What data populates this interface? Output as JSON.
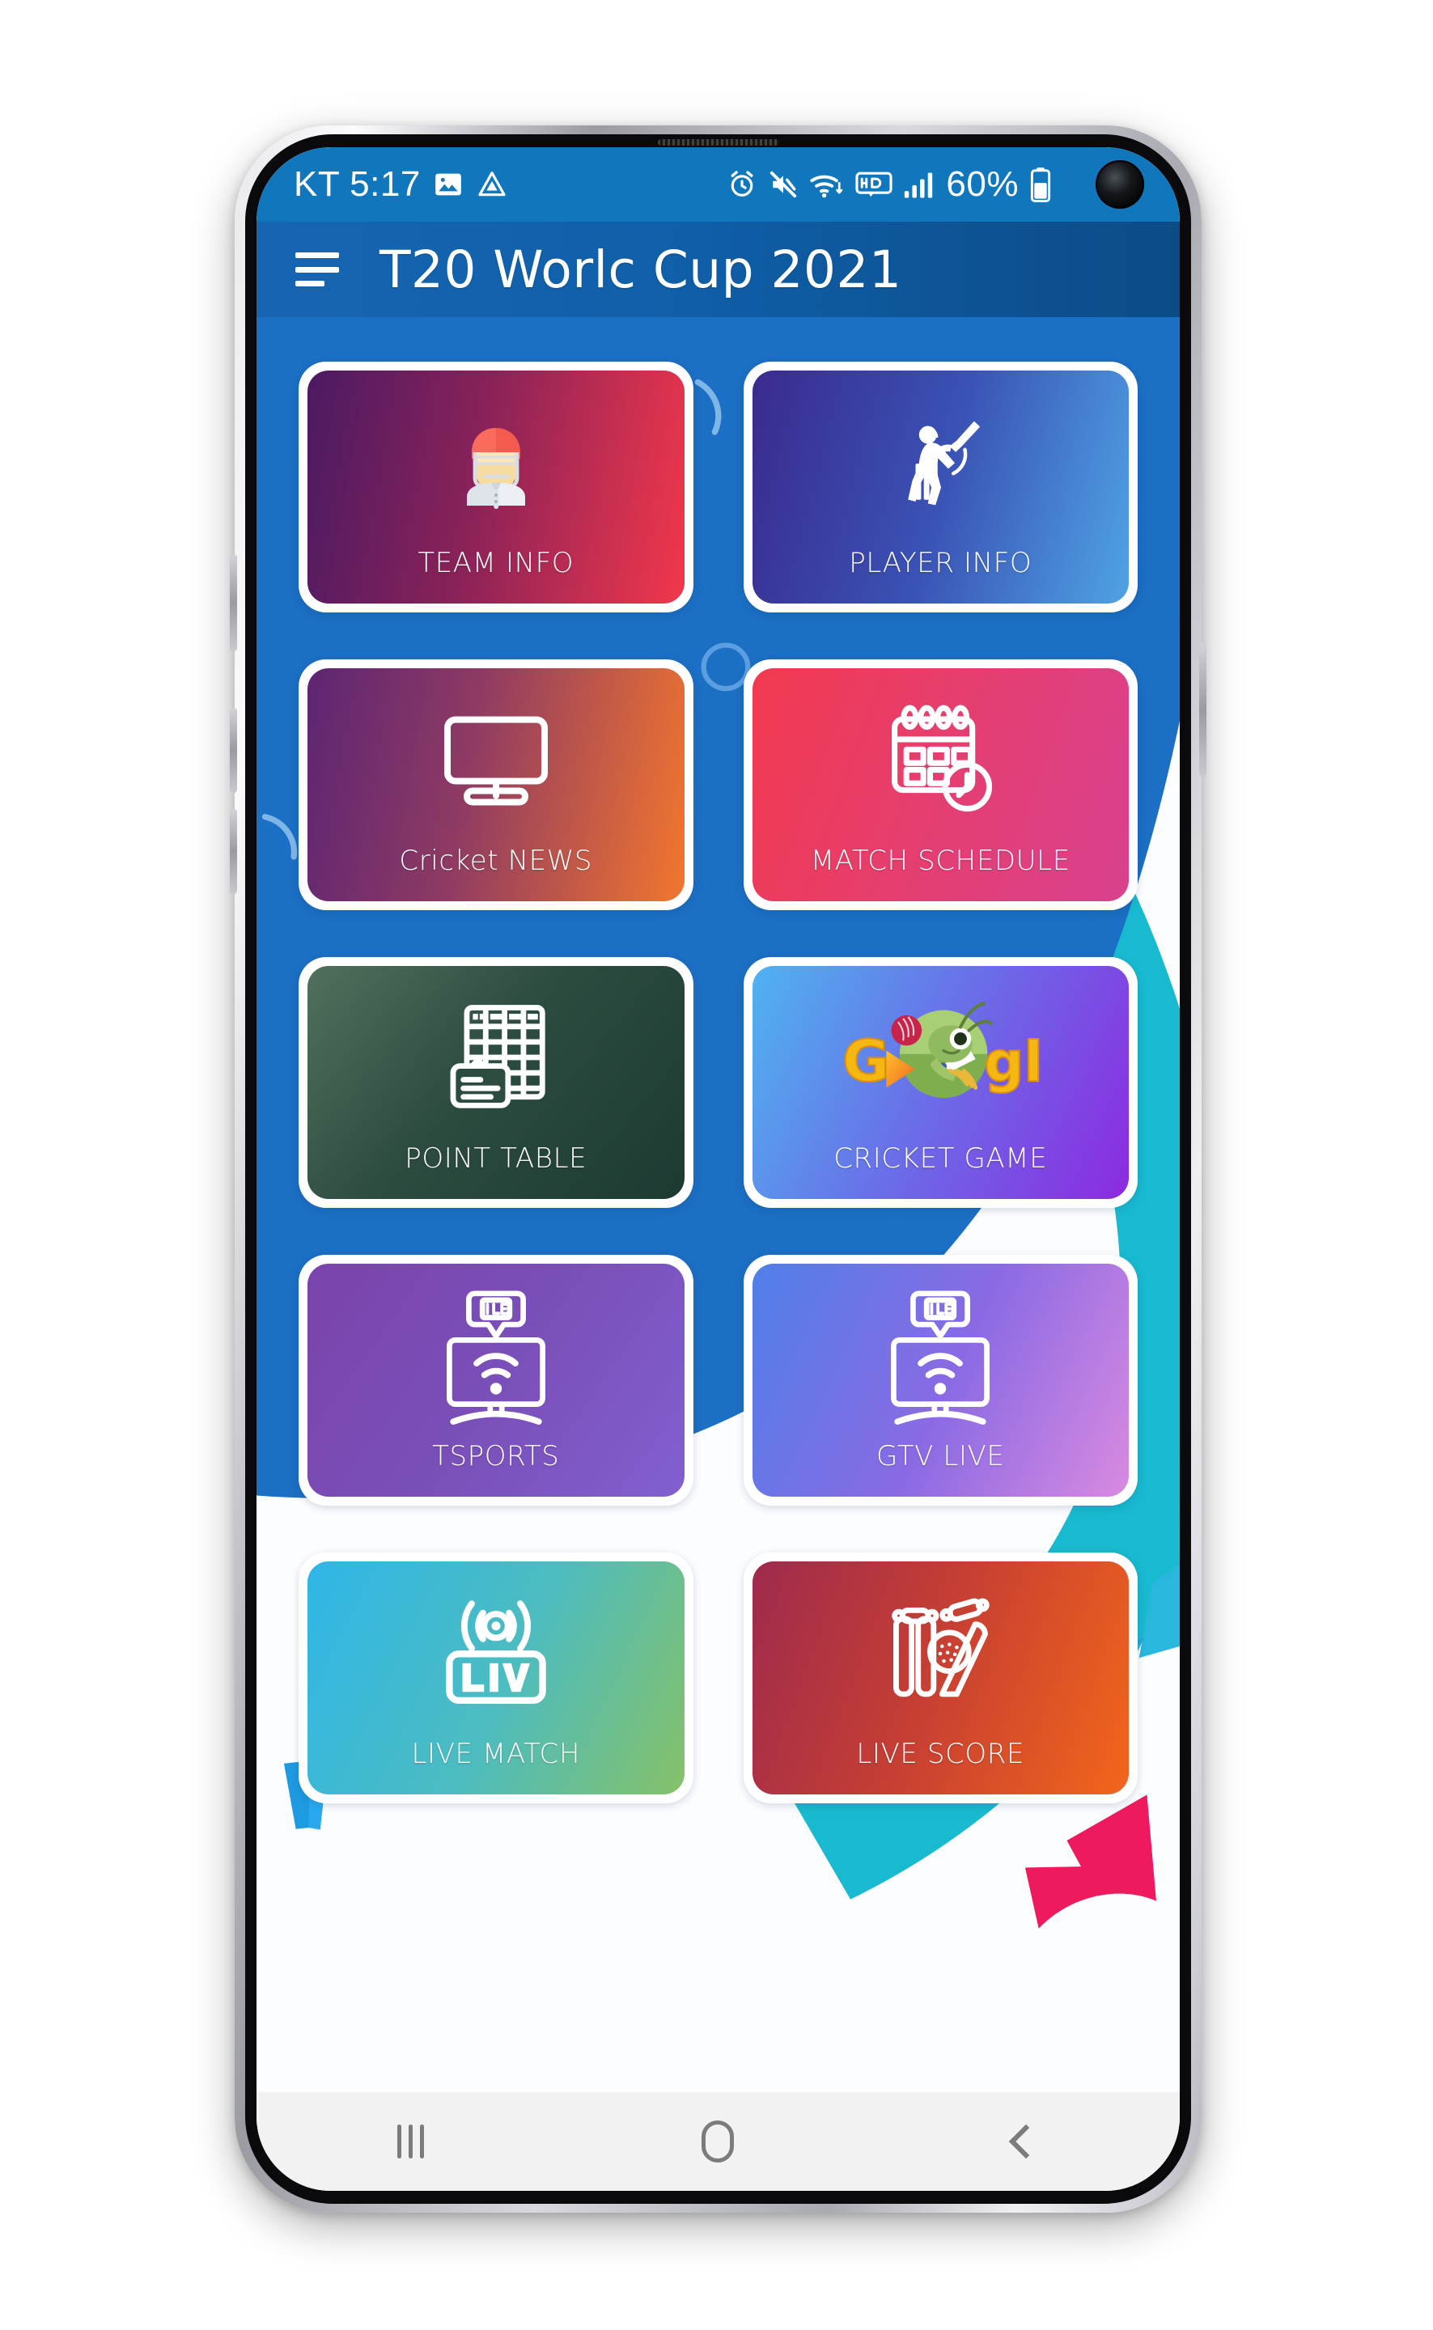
{
  "device": {
    "platform": "android",
    "camera": "punch-hole-camera"
  },
  "status_bar": {
    "carrier_time": "KT 5:17",
    "left_icons": [
      "photo-icon",
      "drive-icon"
    ],
    "right_icons": [
      "alarm-icon",
      "mute-icon",
      "wifi-icon",
      "hd-icon",
      "signal-icon"
    ],
    "battery_percent": "60%",
    "battery_icon": "battery-icon",
    "background_color": "#1077bd"
  },
  "app_bar": {
    "menu_icon": "hamburger-menu-icon",
    "title": "T20 Worlc Cup 2021",
    "background_color": "#0f5fa9"
  },
  "background": {
    "blue_color": "#1b6fc4",
    "teal_color": "#17b9cf",
    "white_color": "#fbfdff",
    "accent_pink": "#ef1a5e",
    "accent_blue": "#1e9ae2"
  },
  "grid": {
    "tiles": [
      {
        "label": "TEAM INFO",
        "icon": "cricket-helmet-player-icon",
        "gradient_from": "#4b1a63",
        "gradient_to": "#f2374b"
      },
      {
        "label": "PLAYER INFO",
        "icon": "batsman-icon",
        "gradient_from": "#3b2a8e",
        "gradient_to": "#4a9fe0"
      },
      {
        "label": "Cricket NEWS",
        "icon": "monitor-icon",
        "gradient_from": "#5d2573",
        "gradient_to": "#f2762e"
      },
      {
        "label": "MATCH SCHEDULE",
        "icon": "calendar-clock-icon",
        "gradient_from": "#f2394f",
        "gradient_to": "#d9418f"
      },
      {
        "label": "POINT TABLE",
        "icon": "points-table-icon",
        "gradient_from": "#4c6a58",
        "gradient_to": "#1f3d33"
      },
      {
        "label": "CRICKET GAME",
        "icon": "google-cricket-doodle-icon",
        "gradient_from": "#4fb3f0",
        "gradient_to": "#8c2ae0"
      },
      {
        "label": "TSPORTS",
        "icon": "live-tv-icon",
        "gradient_from": "#7a44ab",
        "gradient_to": "#7b55cf"
      },
      {
        "label": "GTV LIVE",
        "icon": "live-tv-icon",
        "gradient_from": "#4f7fe8",
        "gradient_to": "#d98ae0"
      },
      {
        "label": "LIVE MATCH",
        "icon": "live-broadcast-icon",
        "gradient_from": "#2fb6e8",
        "gradient_to": "#7fbf67"
      },
      {
        "label": "LIVE SCORE",
        "icon": "cricket-stumps-bat-ball-icon",
        "gradient_from": "#9e2a4d",
        "gradient_to": "#f2661a"
      }
    ]
  },
  "nav_bar": {
    "recents_label": "recents-icon",
    "home_label": "home-icon",
    "back_label": "back-icon",
    "background_color": "#f2f2f2"
  }
}
